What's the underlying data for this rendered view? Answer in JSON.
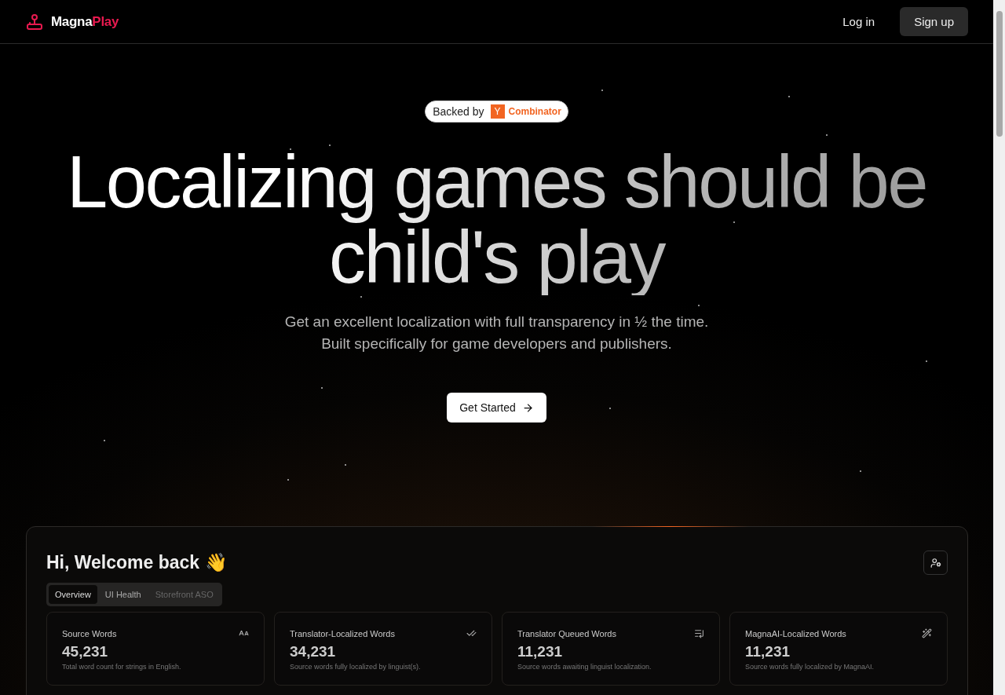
{
  "nav": {
    "brand_first": "Magna",
    "brand_second": "Play",
    "links": [
      {
        "label": "Log in",
        "kind": "link"
      },
      {
        "label": "Sign up",
        "kind": "button"
      }
    ]
  },
  "hero": {
    "badge": {
      "prefix": "Backed by",
      "mark": "Y",
      "name": "Combinator"
    },
    "headline": [
      "Localizing games should be",
      "child's play"
    ],
    "subtitle": [
      "Get an excellent localization with full transparency in ½ the time.",
      "Built specifically for game developers and publishers."
    ],
    "cta": "Get Started"
  },
  "dashboard": {
    "greeting": "Hi, Welcome back",
    "emoji": "👋",
    "tabs": [
      {
        "label": "Overview",
        "selected": true,
        "disabled": false
      },
      {
        "label": "UI Health",
        "selected": false,
        "disabled": false
      },
      {
        "label": "Storefront ASO",
        "selected": false,
        "disabled": true
      }
    ],
    "stats": [
      {
        "title": "Source Words",
        "value": "45,231",
        "note": "Total word count for strings in English."
      },
      {
        "title": "Translator-Localized Words",
        "value": "34,231",
        "note": "Source words fully localized by linguist(s)."
      },
      {
        "title": "Translator Queued Words",
        "value": "11,231",
        "note": "Source words awaiting linguist localization."
      },
      {
        "title": "MagnaAI-Localized Words",
        "value": "11,231",
        "note": "Source words fully localized by MagnaAI."
      }
    ]
  }
}
